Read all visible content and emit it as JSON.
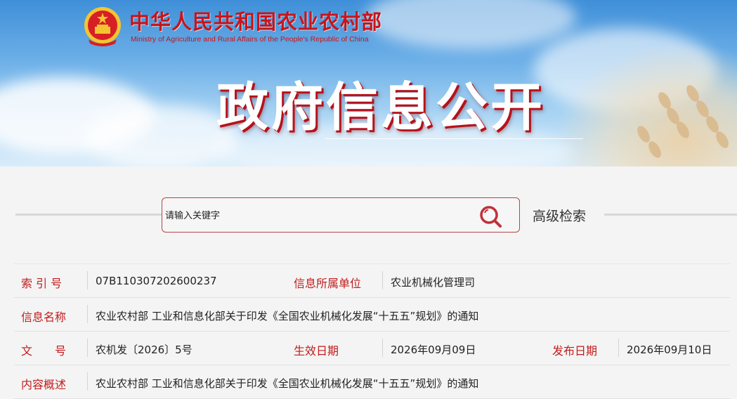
{
  "header": {
    "ministry_cn": "中华人民共和国农业农村部",
    "ministry_en": "Ministry of Agriculture and Rural Affairs of the People's Republic of China",
    "title": "政府信息公开",
    "emblem_icon": "national-emblem-icon"
  },
  "search": {
    "placeholder": "请输入关键字",
    "icon": "search-icon",
    "advanced_label": "高级检索"
  },
  "info": {
    "index_label": "索 引 号",
    "index_value": "07B110307202600237",
    "unit_label": "信息所属单位",
    "unit_value": "农业机械化管理司",
    "name_label": "信息名称",
    "name_value": "农业农村部 工业和信息化部关于印发《全国农业机械化发展“十五五”规划》的通知",
    "doc_label": "文　　号",
    "doc_value": "农机发〔2026〕5号",
    "effective_label": "生效日期",
    "effective_value": "2026年09月09日",
    "publish_label": "发布日期",
    "publish_value": "2026年09月10日",
    "summary_label": "内容概述",
    "summary_value": "农业农村部 工业和信息化部关于印发《全国农业机械化发展“十五五”规划》的通知"
  },
  "colors": {
    "brand_red": "#c21c1c",
    "banner_sky": "#6fb1e8",
    "search_border": "#b8434b"
  }
}
